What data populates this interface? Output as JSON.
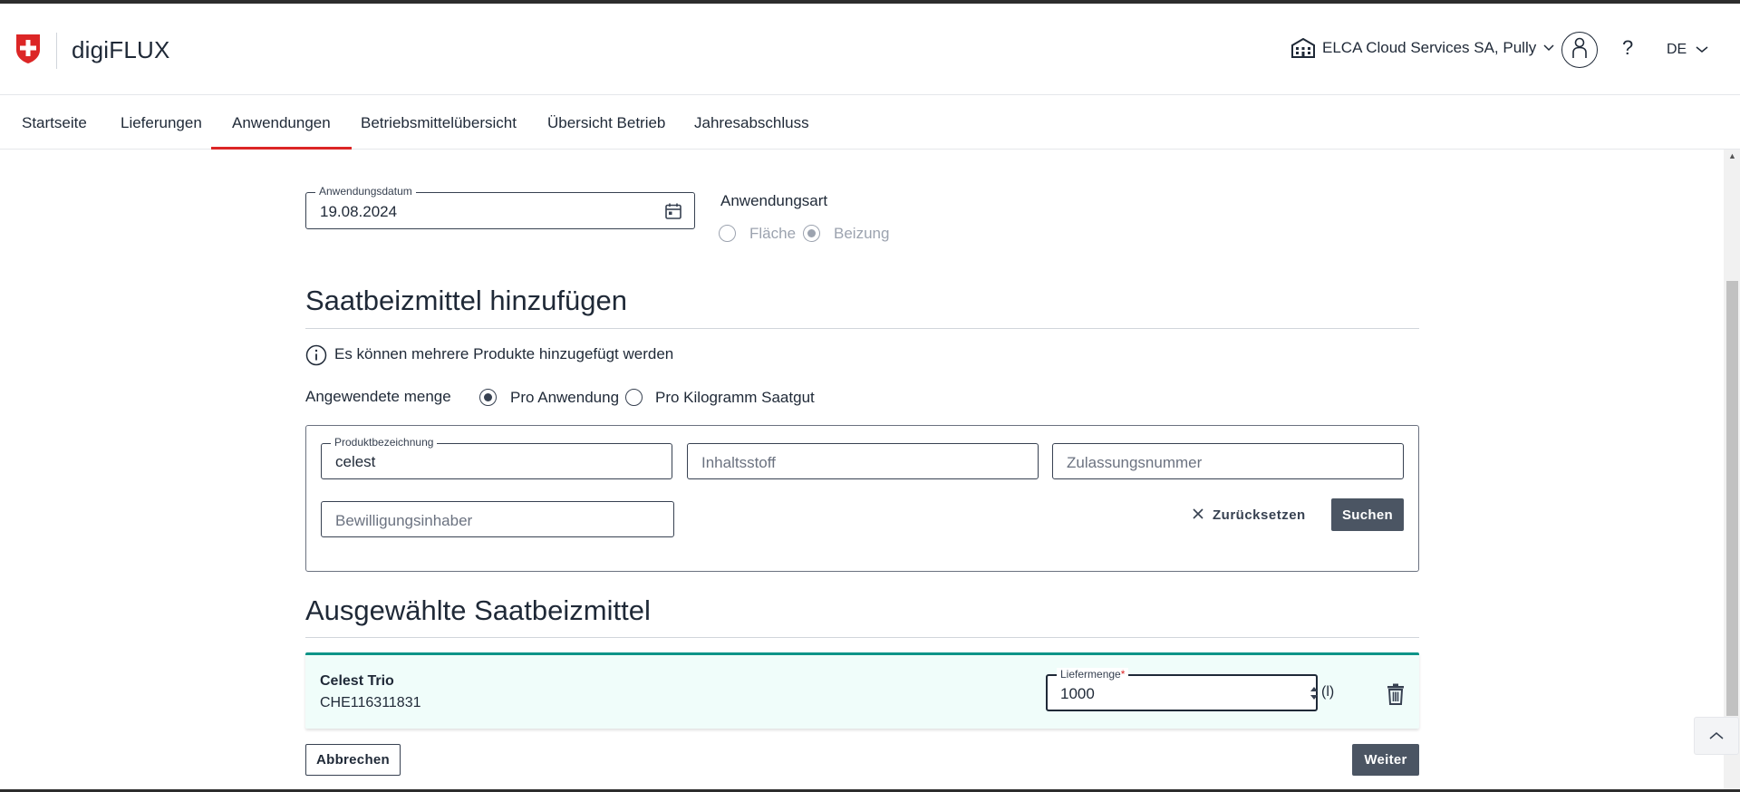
{
  "header": {
    "app_title": "digiFLUX",
    "org_name": "ELCA Cloud Services SA, Pully",
    "help_label": "?",
    "language": "DE"
  },
  "nav": {
    "items": [
      {
        "label": "Startseite"
      },
      {
        "label": "Lieferungen"
      },
      {
        "label": "Anwendungen"
      },
      {
        "label": "Betriebsmittelübersicht"
      },
      {
        "label": "Übersicht Betrieb"
      },
      {
        "label": "Jahresabschluss"
      }
    ],
    "active_index": 2
  },
  "application": {
    "date_label": "Anwendungsdatum",
    "date_value": "19.08.2024",
    "type_label": "Anwendungsart",
    "type_options": [
      "Fläche",
      "Beizung"
    ],
    "type_selected": "Beizung"
  },
  "add_section": {
    "title": "Saatbeizmittel hinzufügen",
    "info_text": "Es können mehrere Produkte hinzugefügt werden",
    "quantity_label": "Angewendete menge",
    "quantity_options": [
      "Pro Anwendung",
      "Pro Kilogramm Saatgut"
    ],
    "quantity_selected": "Pro Anwendung"
  },
  "search": {
    "product_label": "Produktbezeichnung",
    "product_value": "celest",
    "ingredient_placeholder": "Inhaltsstoff",
    "approval_placeholder": "Zulassungsnummer",
    "holder_placeholder": "Bewilligungsinhaber",
    "reset_label": "Zurücksetzen",
    "search_label": "Suchen"
  },
  "selected_section": {
    "title": "Ausgewählte Saatbeizmittel",
    "items": [
      {
        "name": "Celest Trio",
        "number": "CHE116311831",
        "quantity_label": "Liefermenge",
        "required_mark": "*",
        "quantity_value": "1000",
        "unit": "(l)"
      }
    ]
  },
  "footer": {
    "cancel_label": "Abbrechen",
    "next_label": "Weiter"
  },
  "colors": {
    "accent_red": "#dc2626",
    "selected_card_bg": "#f0fdfa",
    "selected_card_border": "#0d9488",
    "button_dark": "#4b5563"
  }
}
